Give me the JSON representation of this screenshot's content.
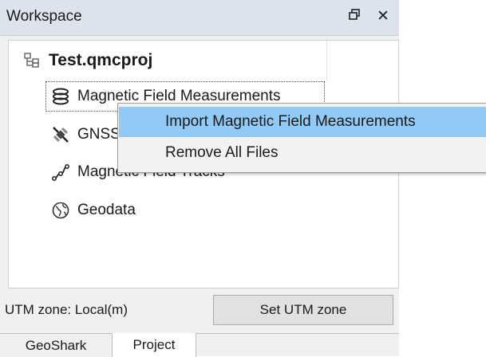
{
  "panel": {
    "title": "Workspace",
    "float_icon": "float-window-icon",
    "close_icon": "close-icon"
  },
  "tree": {
    "root": {
      "label": "Test.qmcproj",
      "icon": "project-tree-icon"
    },
    "items": [
      {
        "label": "Magnetic Field Measurements",
        "icon": "magnetic-coil-icon"
      },
      {
        "label": "GNSS",
        "icon": "satellite-icon"
      },
      {
        "label": "Magnetic Field Tracks",
        "icon": "tracks-icon"
      },
      {
        "label": "Geodata",
        "icon": "globe-icon"
      }
    ]
  },
  "utm": {
    "label": "UTM zone: Local(m)",
    "button": "Set UTM zone"
  },
  "tabs": [
    {
      "label": "GeoShark"
    },
    {
      "label": "Project",
      "active": true
    }
  ],
  "context_menu": {
    "items": [
      {
        "label": "Import Magnetic Field Measurements",
        "highlighted": true
      },
      {
        "label": "Remove All Files"
      }
    ]
  },
  "colors": {
    "highlight": "#91c9f7",
    "titlebar": "#dde3ec"
  }
}
